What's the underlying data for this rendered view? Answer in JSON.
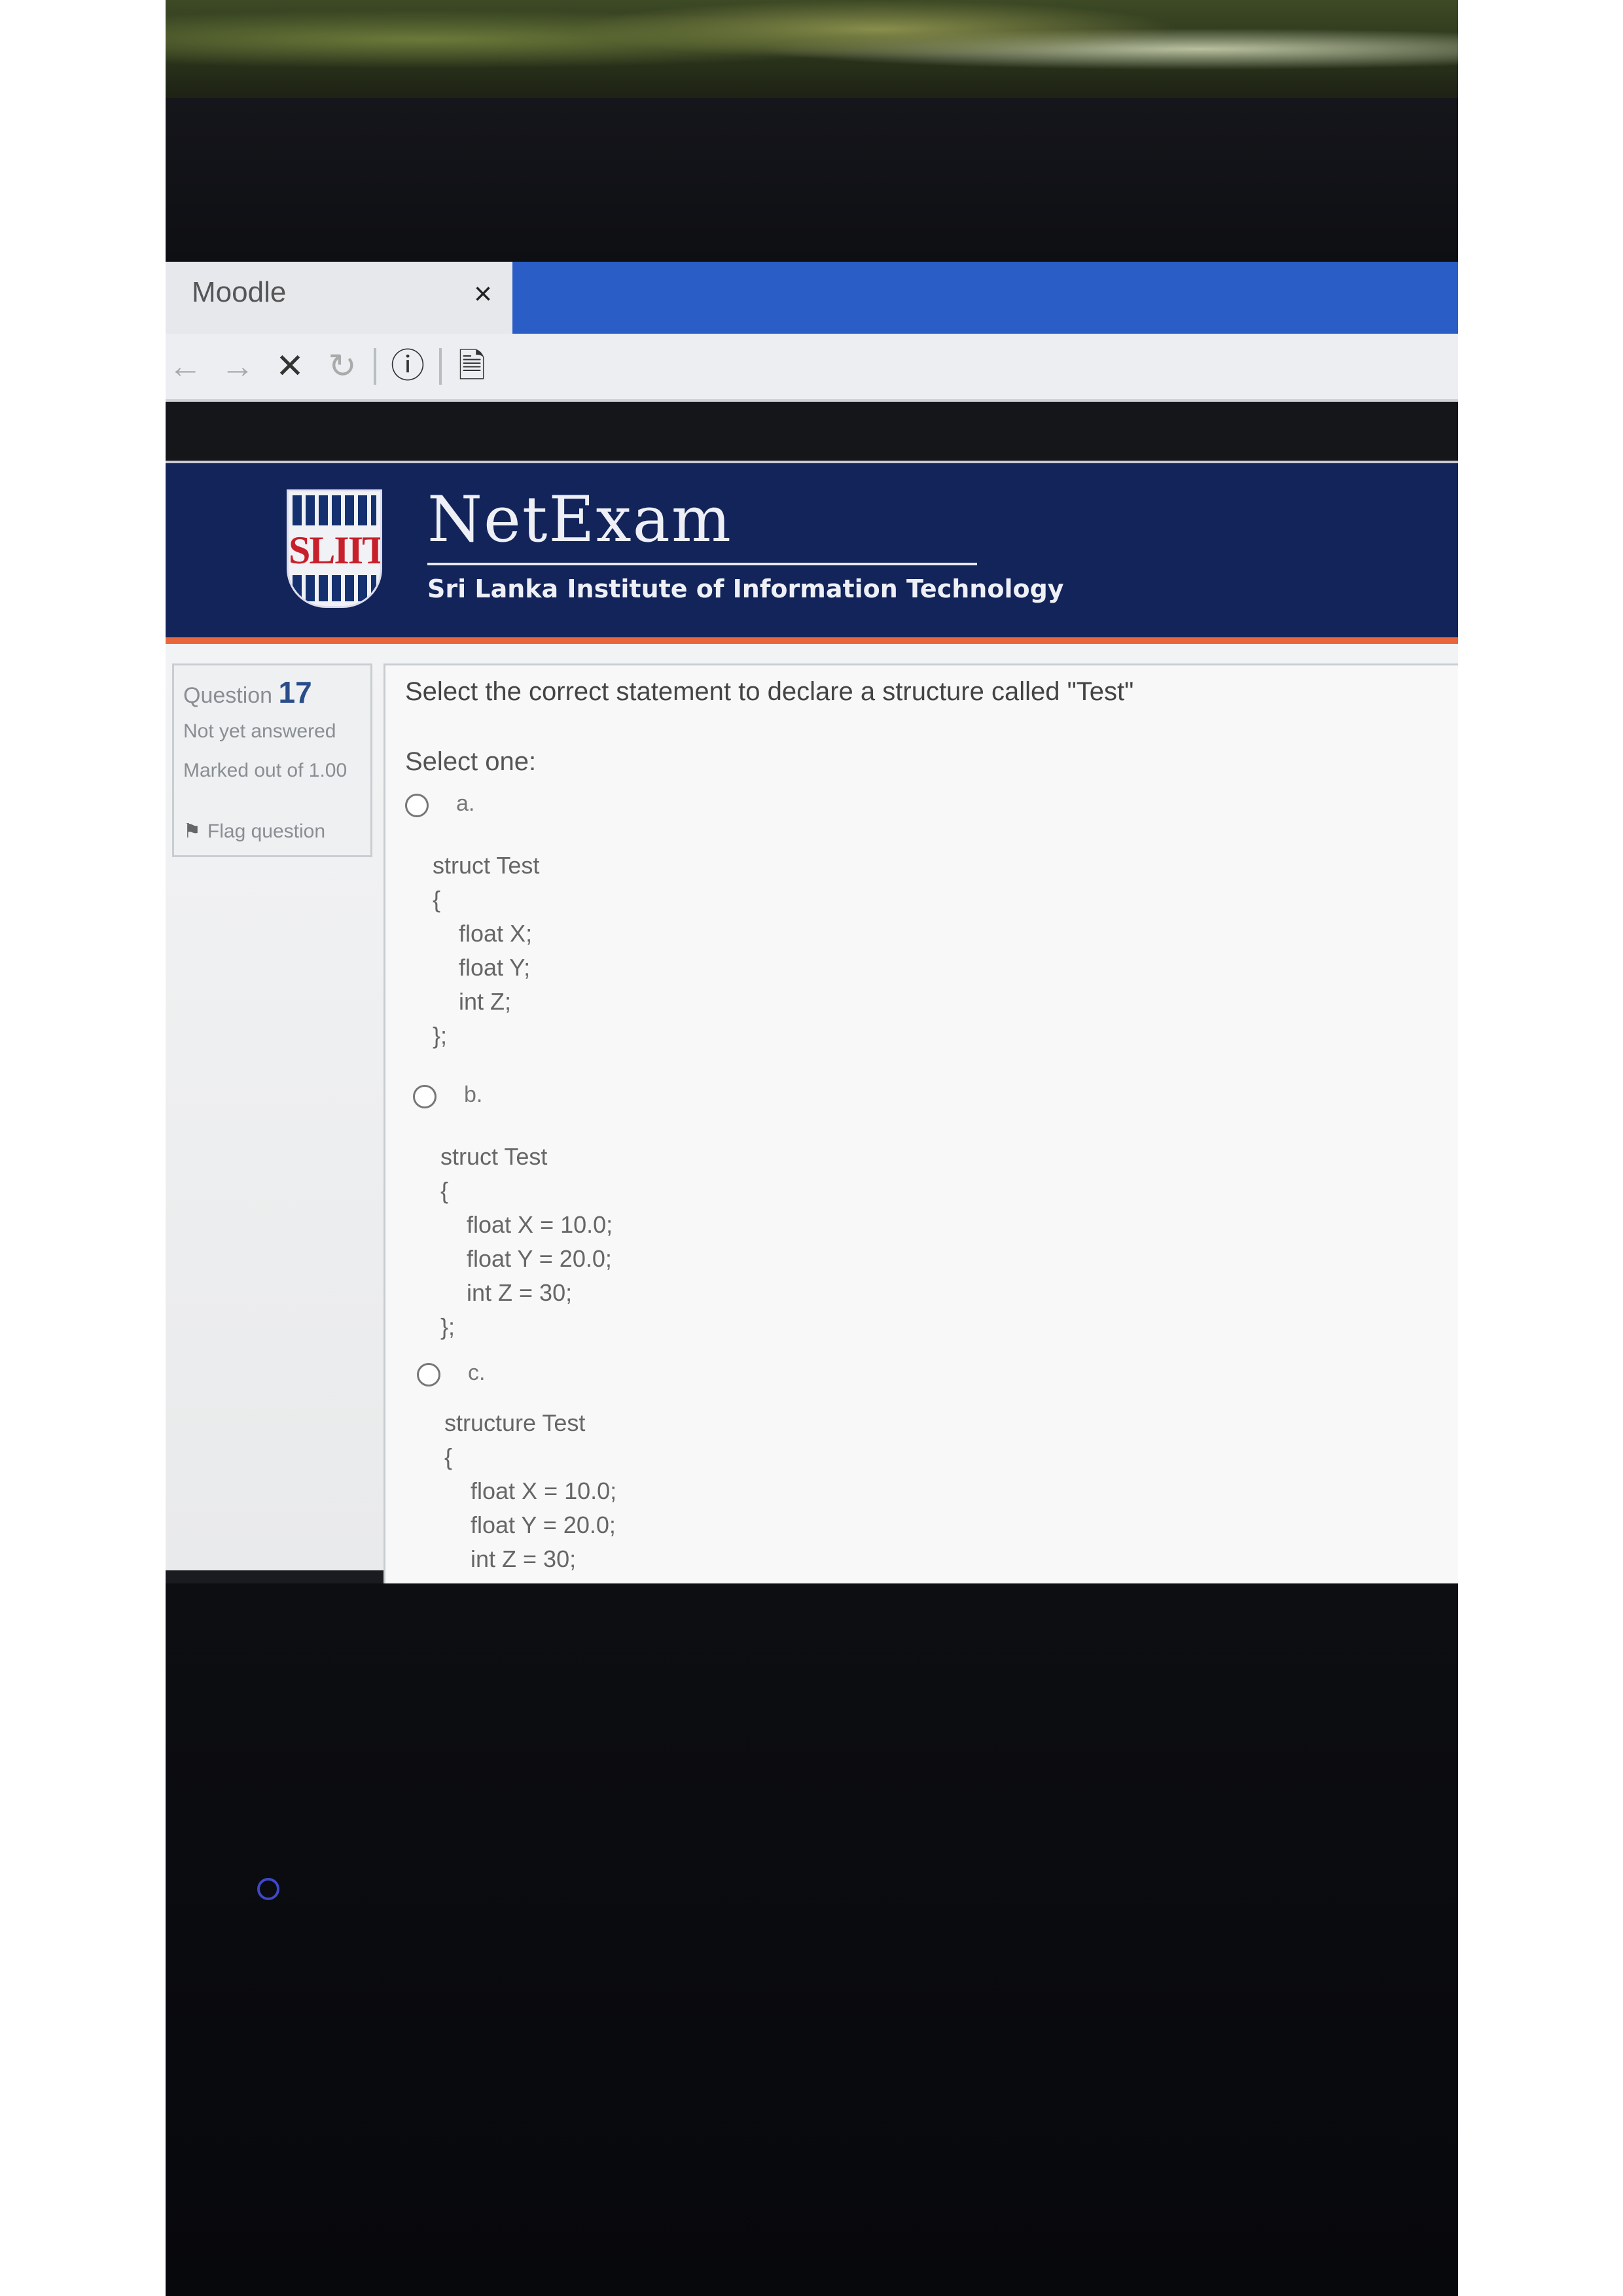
{
  "browser": {
    "tab_title": "Moodle",
    "tab_close": "×",
    "toolbar": {
      "back_icon": "←",
      "forward_icon": "→",
      "stop_icon": "✕",
      "reload_icon": "↻",
      "info_icon": "ⓘ",
      "page_icon": "🗎"
    }
  },
  "header": {
    "logo_text": "SLIIT",
    "app_title": "NetExam",
    "subtitle": "Sri Lanka Institute of Information Technology"
  },
  "question_info": {
    "label": "Question",
    "number": "17",
    "state": "Not yet answered",
    "marked": "Marked out of 1.00",
    "flag": "Flag question"
  },
  "question": {
    "text": "Select the correct statement to declare a structure called \"Test\"",
    "select_one": "Select one:",
    "options": [
      {
        "letter": "a.",
        "code": "struct Test\n{\n    float X;\n    float Y;\n    int Z;\n};"
      },
      {
        "letter": "b.",
        "code": "struct Test\n{\n    float X = 10.0;\n    float Y = 20.0;\n    int Z = 30;\n};"
      },
      {
        "letter": "c.",
        "code": "structure Test\n{\n    float X = 10.0;\n    float Y = 20.0;\n    int Z = 30;"
      }
    ]
  },
  "colors": {
    "header_bg": "#12245a",
    "accent": "#e8663a",
    "tab_bar": "#2a5dc6"
  }
}
